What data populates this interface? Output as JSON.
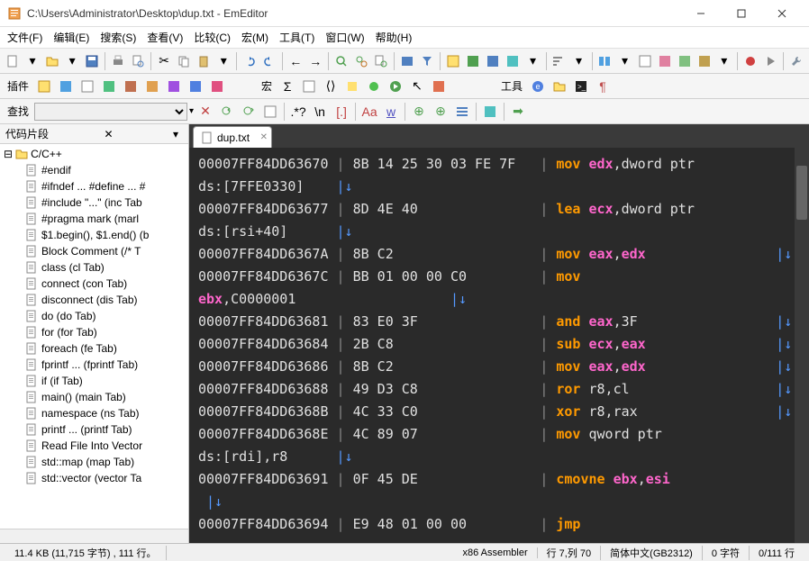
{
  "titlebar": {
    "path": "C:\\Users\\Administrator\\Desktop\\dup.txt - EmEditor"
  },
  "menu": {
    "file": "文件(F)",
    "edit": "编辑(E)",
    "search": "搜索(S)",
    "view": "查看(V)",
    "compare": "比较(C)",
    "macro": "宏(M)",
    "tools": "工具(T)",
    "window": "窗口(W)",
    "help": "帮助(H)"
  },
  "toolbar2": {
    "plugins_label": "插件",
    "macro_label": "宏",
    "tools_label": "工具"
  },
  "searchbar": {
    "label": "查找",
    "value": ""
  },
  "sidebar": {
    "title": "代码片段",
    "folder": "C/C++",
    "items": [
      "#endif",
      "#ifndef ... #define ... #",
      "#include \"...\"  (inc Tab",
      "#pragma mark  (marl",
      "$1.begin(), $1.end()  (b",
      "Block Comment  (/* T",
      "class   (cl Tab)",
      "connect  (con Tab)",
      "disconnect  (dis Tab)",
      "do  (do Tab)",
      "for  (for Tab)",
      "foreach  (fe Tab)",
      "fprintf ...  (fprintf Tab)",
      "if  (if Tab)",
      "main()  (main Tab)",
      "namespace  (ns Tab)",
      "printf ...  (printf Tab)",
      "Read File Into Vector",
      "std::map  (map Tab)",
      "std::vector  (vector Ta"
    ]
  },
  "tab": {
    "name": "dup.txt"
  },
  "editor_lines": [
    {
      "addr": "00007FF84DD63670",
      "hex": "8B 14 25 30 03 FE 7F",
      "op": "mov",
      "reg": "edx",
      "tail": ",dword ptr"
    },
    {
      "cont": "ds:[7FFE0330]",
      "arrow": "↓"
    },
    {
      "addr": "00007FF84DD63677",
      "hex": "8D 4E 40",
      "op": "lea",
      "reg": "ecx",
      "tail": ",dword ptr"
    },
    {
      "cont": "ds:[rsi+40]",
      "arrow": "↓"
    },
    {
      "addr": "00007FF84DD6367A",
      "hex": "8B C2",
      "op": "mov",
      "reg": "eax",
      "reg2": "edx",
      "end_arrow": "↓"
    },
    {
      "addr": "00007FF84DD6367C",
      "hex": "BB 01 00 00 C0",
      "op": "mov"
    },
    {
      "cont_reg": "ebx",
      "cont_tail": ",C0000001",
      "arrow": "↓"
    },
    {
      "addr": "00007FF84DD63681",
      "hex": "83 E0 3F",
      "op": "and",
      "reg": "eax",
      "lit": ",3F",
      "end_arrow": "↓"
    },
    {
      "addr": "00007FF84DD63684",
      "hex": "2B C8",
      "op": "sub",
      "reg": "ecx",
      "reg2": "eax",
      "end_arrow": "↓"
    },
    {
      "addr": "00007FF84DD63686",
      "hex": "8B C2",
      "op": "mov",
      "reg": "eax",
      "reg2": "edx",
      "end_arrow": "↓"
    },
    {
      "addr": "00007FF84DD63688",
      "hex": "49 D3 C8",
      "op": "ror",
      "txt": " r8,cl",
      "end_arrow": "↓"
    },
    {
      "addr": "00007FF84DD6368B",
      "hex": "4C 33 C0",
      "op": "xor",
      "txt": " r8,rax",
      "end_arrow": "↓"
    },
    {
      "addr": "00007FF84DD6368E",
      "hex": "4C 89 07",
      "op": "mov",
      "txt": " qword ptr"
    },
    {
      "cont": "ds:[rdi],r8",
      "arrow": "↓"
    },
    {
      "addr": "00007FF84DD63691",
      "hex": "0F 45 DE",
      "op": "cmovne",
      "reg": "ebx",
      "reg2": "esi"
    },
    {
      "arrow_only": "↓"
    },
    {
      "addr": "00007FF84DD63694",
      "hex": "E9 48 01 00 00",
      "op": "jmp"
    }
  ],
  "status": {
    "left": "11.4 KB (11,715 字节) , 111 行。",
    "lang": "x86 Assembler",
    "pos": "行 7,列 70",
    "encoding": "简体中文(GB2312)",
    "chars": "0 字符",
    "lines": "0/111 行"
  }
}
